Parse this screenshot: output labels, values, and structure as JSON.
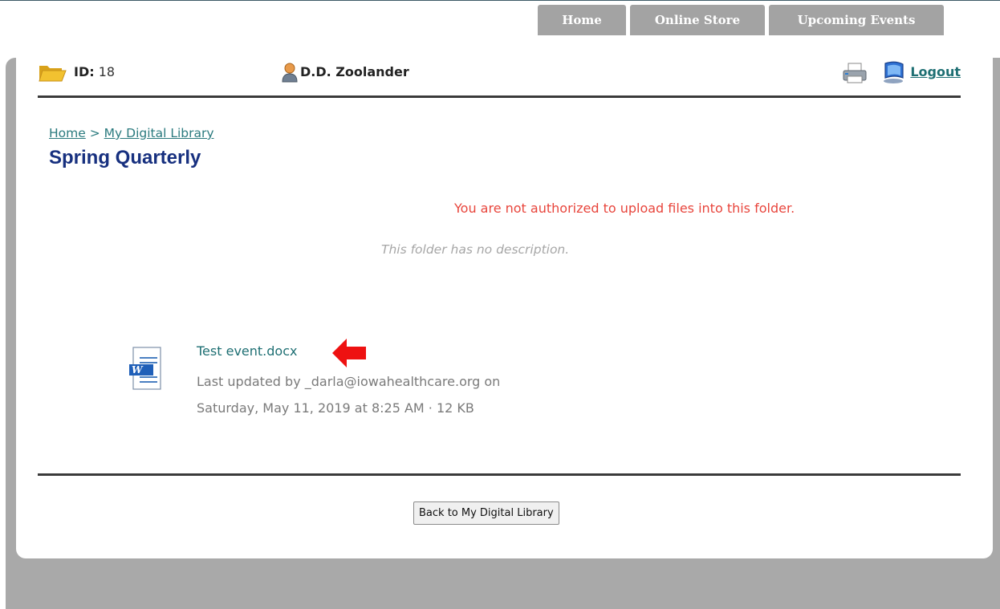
{
  "nav": {
    "tabs": [
      {
        "label": "Home"
      },
      {
        "label": "Online Store"
      },
      {
        "label": "Upcoming Events"
      }
    ]
  },
  "userbar": {
    "id_label": "ID:",
    "id_value": "18",
    "username": "D.D. Zoolander",
    "logout_label": "Logout"
  },
  "breadcrumb": {
    "home": "Home",
    "separator": ">",
    "library": "My Digital Library"
  },
  "page": {
    "title": "Spring Quarterly",
    "upload_notice": "You are not authorized to upload files into this folder.",
    "folder_description": "This folder has no description."
  },
  "files": [
    {
      "name": "Test event.docx",
      "meta_line1": "Last updated by _darla@iowahealthcare.org on",
      "meta_line2": "Saturday, May 11, 2019 at 8:25 AM · 12 KB"
    }
  ],
  "actions": {
    "back_label": "Back to My Digital Library"
  },
  "colors": {
    "title": "#17307f",
    "link": "#1e6f73",
    "notice": "#e8453c",
    "tab_bg": "#a3a3a3",
    "frame_gray": "#a9a9a9",
    "annotation_arrow": "#ee1111"
  }
}
